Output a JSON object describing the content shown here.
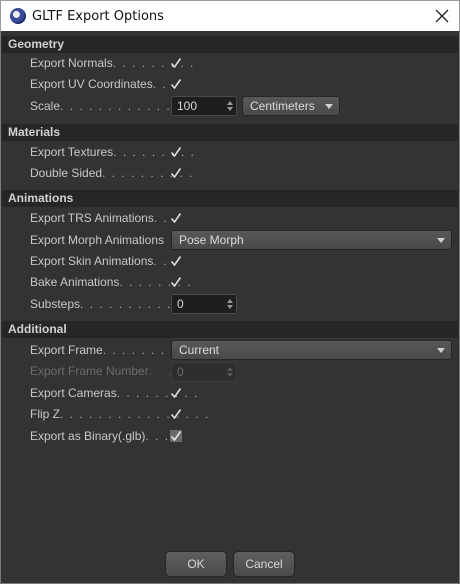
{
  "window": {
    "title": "GLTF Export Options"
  },
  "sections": {
    "geometry": "Geometry",
    "materials": "Materials",
    "animations": "Animations",
    "additional": "Additional"
  },
  "fields": {
    "export_normals": {
      "label": "Export Normals",
      "checked": true
    },
    "export_uv": {
      "label": "Export UV Coordinates",
      "checked": true
    },
    "scale": {
      "label": "Scale",
      "value": "100",
      "unit": "Centimeters"
    },
    "export_textures": {
      "label": "Export Textures",
      "checked": true
    },
    "double_sided": {
      "label": "Double Sided",
      "checked": true
    },
    "export_trs": {
      "label": "Export TRS Animations",
      "checked": true
    },
    "export_morph": {
      "label": "Export Morph Animations",
      "value": "Pose Morph"
    },
    "export_skin": {
      "label": "Export Skin Animations",
      "checked": true
    },
    "bake_animations": {
      "label": "Bake Animations",
      "checked": true
    },
    "substeps": {
      "label": "Substeps",
      "value": "0"
    },
    "export_frame": {
      "label": "Export Frame",
      "value": "Current"
    },
    "export_frame_number": {
      "label": "Export Frame Number",
      "value": "0",
      "disabled": true
    },
    "export_cameras": {
      "label": "Export Cameras",
      "checked": true
    },
    "flip_z": {
      "label": "Flip Z",
      "checked": true
    },
    "export_binary": {
      "label": "Export as Binary(.glb)",
      "checked": true
    }
  },
  "buttons": {
    "ok": "OK",
    "cancel": "Cancel"
  },
  "colors": {
    "background": "#333333",
    "section_header": "#262626",
    "field": "#1e1e1e",
    "text": "#c8c8c8"
  }
}
